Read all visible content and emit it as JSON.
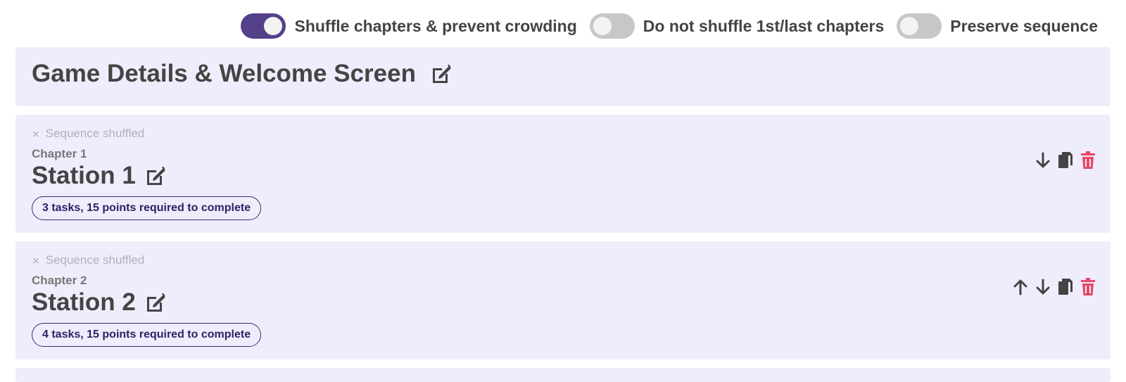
{
  "toggles": [
    {
      "label": "Shuffle chapters & prevent crowding",
      "state": "on",
      "icon": "toggle-switch"
    },
    {
      "label": "Do not shuffle 1st/last chapters",
      "state": "off",
      "icon": "toggle-switch"
    },
    {
      "label": "Preserve sequence",
      "state": "off",
      "icon": "toggle-switch"
    }
  ],
  "details": {
    "title": "Game Details & Welcome Screen",
    "edit_icon": "edit-icon"
  },
  "chapters": [
    {
      "shuffle_note": "Sequence shuffled",
      "shuffle_icon": "shuffle-icon",
      "chapter_label": "Chapter 1",
      "title": "Station 1",
      "requirement": "3 tasks, 15 points required to complete",
      "actions": [
        "move-down-icon",
        "copy-icon",
        "delete-icon"
      ]
    },
    {
      "shuffle_note": "Sequence shuffled",
      "shuffle_icon": "shuffle-icon",
      "chapter_label": "Chapter 2",
      "title": "Station 2",
      "requirement": "4 tasks, 15 points required to complete",
      "actions": [
        "move-up-icon",
        "move-down-icon",
        "copy-icon",
        "delete-icon"
      ]
    }
  ],
  "colors": {
    "toggle_on": "#55408a",
    "toggle_off": "#c7c7c7",
    "panel_background": "#efedfb",
    "badge_border": "#3a2a73",
    "delete_icon": "#e8476a",
    "text_dark": "#444444"
  }
}
